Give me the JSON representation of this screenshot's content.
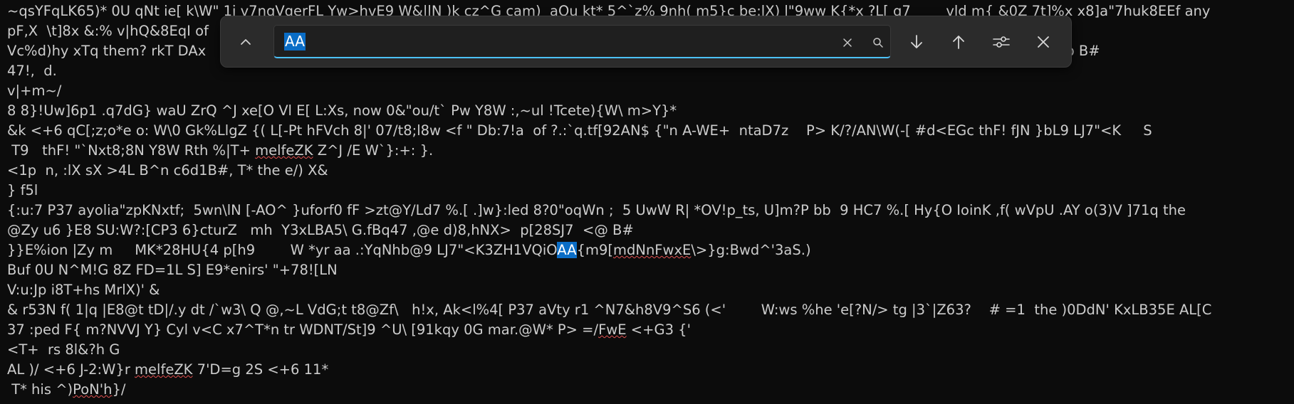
{
  "terminal": {
    "lines": [
      {
        "segments": [
          {
            "t": "~qsYFqLK65)* 0U qNt ie[ k\\W\" 1i v7nqVqerFL Yw>hvE9 W&|lN )k cz^G cam)  aQu kt* 5^`z% 9nh( m5}c be:lX) l\"9ww K{*x ?L[ q7        vld m{ &0Z 7t]%x x8]a\"7huk8EEf any"
          }
        ]
      },
      {
        "segments": [
          {
            "t": "pF,X  \\t]8x &:% v|hQ&8EqI of"
          }
        ]
      },
      {
        "segments": [
          {
            "t": "Vc%d)hy xTq them? rkT DAx"
          },
          {
            "t": "                                                                                                                                                             "
          },
          {
            "t": "efrm\".DNXOMI   8E 6W6p B#"
          }
        ]
      },
      {
        "segments": [
          {
            "t": "47!,  d."
          }
        ]
      },
      {
        "segments": [
          {
            "t": "v|+m~/"
          }
        ]
      },
      {
        "segments": [
          {
            "t": "8 8}!Uw]6p1 .q7dG} waU ZrQ ^J xe[O Vl E[ L:Xs, now 0&\"ou/t` Pw Y8W :,~ul !Tcete){W\\ m>Y}*"
          }
        ]
      },
      {
        "segments": [
          {
            "t": "&k <+6 qC[;z;o*e o: W\\0 Gk%LlgZ {( L[-Pt hFVch 8|' 07/t8;l8w <f \" Db:7!a  of ?.:`q.tf[92AN$ {\"n A-WE+  ntaD7z    P> K/?/AN\\W(-[ #d<EGc thF! fJN }bL9 LJ7\"<K     S"
          }
        ]
      },
      {
        "segments": [
          {
            "t": " T9   thF! \"`Nxt8;8N Y8W Rth %|T+ "
          },
          {
            "t": "melfeZK",
            "ul": true
          },
          {
            "t": " Z^J /E W`}:+: }."
          }
        ]
      },
      {
        "segments": [
          {
            "t": "<1p  n, :lX sX >4L B^n c6d1B#, T* the e/) X&"
          }
        ]
      },
      {
        "segments": [
          {
            "t": "} f5l"
          }
        ]
      },
      {
        "segments": [
          {
            "t": "{:u:7 P37 ayolia\"zpKNxtf;  5wn\\lN [-AO^ }uforf0 fF >zt@Y/Ld7 %.[ .]w}:led 8?0\"oqWn ;  5 UwW R| *OV!p_ts, U]m?P bb  9 HC7 %.[ Hy{O IoinK ,f( wVpU .AY o(3)V ]71q the"
          }
        ]
      },
      {
        "segments": [
          {
            "t": "@Zy u6 }E8 SU:W?:[CP3 6}cturZ   mh  Y3xLBA5\\ G.fBq47 ,@e d)8,hNX>  p[28SJ7  <@ B#"
          }
        ]
      },
      {
        "segments": [
          {
            "t": "}}E%ion |Zy m     MK*28HU{4 p[h9        W *yr aa .:YqNhb@9 LJ7\"<K3ZH1VQiO"
          },
          {
            "t": "AA",
            "hl": true
          },
          {
            "t": "{m9["
          },
          {
            "t": "mdNnFwxE",
            "ul": true
          },
          {
            "t": "\\>}g:Bwd^'3aS.)"
          }
        ]
      },
      {
        "segments": [
          {
            "t": "Buf 0U N^M!G 8Z FD=1L S] E9*enirs' \"+78![LN"
          }
        ]
      },
      {
        "segments": [
          {
            "t": "V:u:Jp i8T+hs MrlX)' &"
          }
        ]
      },
      {
        "segments": [
          {
            "t": "& r53N f( 1|q |E8@t tD|/.y dt /`w3\\ Q @,~L VdG;t t8@Zf\\   h!x, Ak<l%4[ P37 aVty r1 ^N7&h8V9^S6 (<'        W:ws %he 'e[?N/> tg |3`|Z63?    # =1  the )0DdN' KxLB35E AL[C"
          }
        ]
      },
      {
        "segments": [
          {
            "t": "37 :ped F{ m?NVVJ Y} Cyl v<C x7^T*n tr WDNT/St]9 ^U\\ [91kqy 0G mar.@W* P> =/"
          },
          {
            "t": "FwE",
            "ul": true
          },
          {
            "t": " <+G3 {'"
          }
        ]
      },
      {
        "segments": [
          {
            "t": "<T+  rs 8l&?h G"
          }
        ]
      },
      {
        "segments": [
          {
            "t": "AL )/ <+6 J-2:W}r "
          },
          {
            "t": "melfeZK",
            "ul": true
          },
          {
            "t": " 7'D=g 2S <+6 11*"
          }
        ]
      },
      {
        "segments": [
          {
            "t": " T* his ^)"
          },
          {
            "t": "PoN'h",
            "ul": true
          },
          {
            "t": "}/"
          }
        ]
      }
    ]
  },
  "findbar": {
    "query": "AA",
    "icons": {
      "collapse": "chevron-up-icon",
      "clear": "close-icon",
      "search": "search-icon",
      "next": "arrow-down-icon",
      "prev": "arrow-up-icon",
      "options": "sliders-icon",
      "close": "close-icon"
    }
  },
  "colors": {
    "background": "#0c0c0c",
    "text": "#cccccc",
    "highlight": "#0a6dc6",
    "accent": "#4cc2ff",
    "findbar_bg": "#2b2b2b"
  }
}
